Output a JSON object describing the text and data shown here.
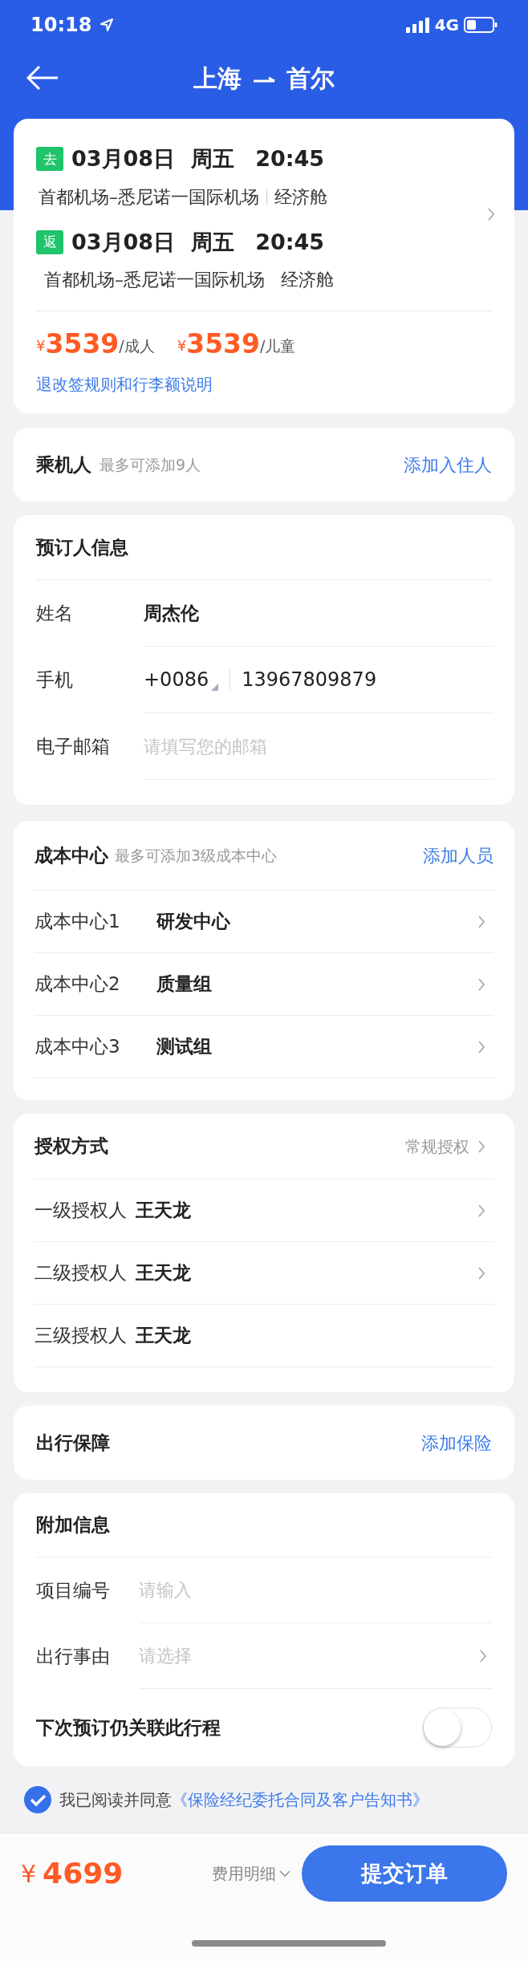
{
  "status_bar": {
    "time": "10:18",
    "network": "4G"
  },
  "header": {
    "from": "上海",
    "to": "首尔"
  },
  "flight": {
    "segments": [
      {
        "tag": "去",
        "date": "03月08日",
        "weekday": "周五",
        "time": "20:45",
        "route": "首都机场–悉尼诺一国际机场",
        "cabin": "经济舱",
        "separator": true
      },
      {
        "tag": "返",
        "date": "03月08日",
        "weekday": "周五",
        "time": "20:45",
        "route": "首都机场–悉尼诺一国际机场",
        "cabin": "经济舱",
        "separator": false
      }
    ],
    "prices": [
      {
        "currency": "¥",
        "amount": "3539",
        "unit": "/成人"
      },
      {
        "currency": "¥",
        "amount": "3539",
        "unit": "/儿童"
      }
    ],
    "rules_link": "退改签规则和行李额说明"
  },
  "passengers": {
    "title": "乘机人",
    "hint": "最多可添加9人",
    "action": "添加入住人"
  },
  "booker": {
    "title": "预订人信息",
    "fields": [
      {
        "kind": "text",
        "label": "姓名",
        "value": "周杰伦"
      },
      {
        "kind": "phone",
        "label": "手机",
        "country_code": "+0086",
        "value": "13967809879"
      },
      {
        "kind": "input",
        "label": "电子邮箱",
        "placeholder": "请填写您的邮箱"
      }
    ]
  },
  "cost_center": {
    "title": "成本中心",
    "hint": "最多可添加3级成本中心",
    "action": "添加人员",
    "rows": [
      {
        "label": "成本中心1",
        "value": "研发中心"
      },
      {
        "label": "成本中心2",
        "value": "质量组"
      },
      {
        "label": "成本中心3",
        "value": "测试组"
      }
    ]
  },
  "authorization": {
    "title": "授权方式",
    "mode": "常规授权",
    "rows": [
      {
        "label": "一级授权人",
        "value": "王天龙",
        "chevron": true
      },
      {
        "label": "二级授权人",
        "value": "王天龙",
        "chevron": true
      },
      {
        "label": "三级授权人",
        "value": "王天龙",
        "chevron": false
      }
    ]
  },
  "protection": {
    "title": "出行保障",
    "action": "添加保险"
  },
  "extra": {
    "title": "附加信息",
    "fields": [
      {
        "kind": "input",
        "label": "项目编号",
        "placeholder": "请输入"
      },
      {
        "kind": "select",
        "label": "出行事由",
        "placeholder": "请选择"
      }
    ],
    "toggle": {
      "label": "下次预订仍关联此行程",
      "on": false
    }
  },
  "agreement": {
    "checked": true,
    "text": "我已阅读并同意",
    "link": "《保险经纪委托合同及客户告知书》"
  },
  "footer": {
    "currency": "¥",
    "total": "4699",
    "details": "费用明细",
    "submit": "提交订单"
  }
}
